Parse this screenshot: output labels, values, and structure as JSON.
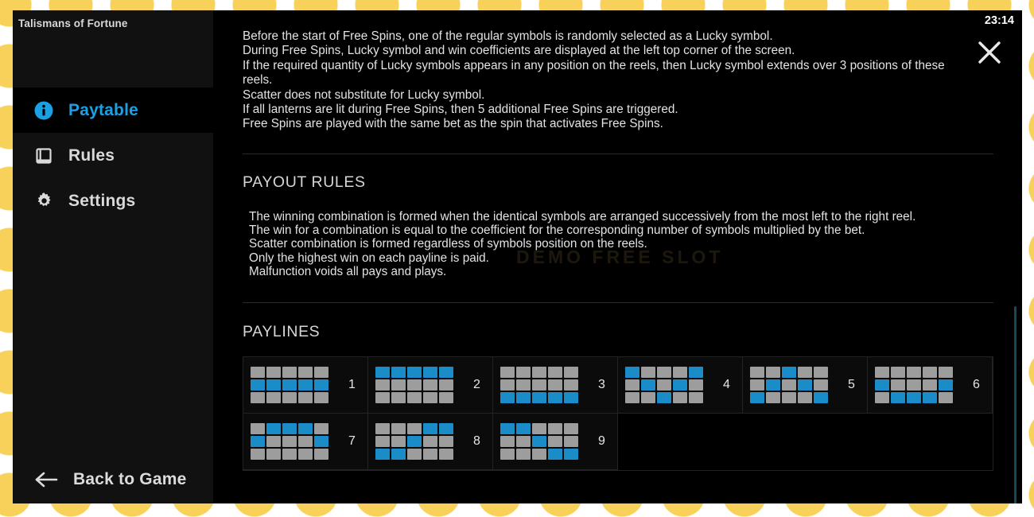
{
  "window": {
    "game_title": "Talismans of Fortune",
    "clock": "23:14",
    "close_icon": "close-x-icon",
    "watermark": "DEMO  FREE SLOT",
    "accent_blue": "#1ca0e4",
    "cell_blue": "#1a8cc8",
    "cell_gray": "#9d9d9d",
    "panel_bg": "#000000",
    "sidebar_bg": "#111111"
  },
  "sidebar": {
    "items": [
      {
        "label": "Paytable",
        "icon": "info-circle-icon",
        "active": true
      },
      {
        "label": "Rules",
        "icon": "book-icon",
        "active": false
      },
      {
        "label": "Settings",
        "icon": "gear-icon",
        "active": false
      }
    ],
    "back": {
      "label": "Back to Game",
      "icon": "arrow-left-icon"
    }
  },
  "main": {
    "intro_lines": [
      "Before the start of Free Spins, one of the regular symbols is randomly selected as a Lucky symbol.",
      "During Free Spins, Lucky symbol and win coefficients are displayed at the left top corner of the screen.",
      "If the required quantity of Lucky symbols appears in any position on the reels, then Lucky symbol extends over 3 positions of these reels.",
      "Scatter does not substitute for Lucky symbol.",
      "If all lanterns are lit during Free Spins, then 5 additional Free Spins are triggered.",
      "Free Spins are played with the same bet as the spin that activates Free Spins."
    ],
    "payout_rules_heading": "PAYOUT RULES",
    "payout_rules_lines": [
      "The winning combination is formed when the identical symbols are arranged successively from the most left to the right reel.",
      "The win for a combination is equal to the coefficient for the corresponding number of symbols multiplied by the bet.",
      "Scatter combination is formed regardless of symbols position on the reels.",
      "Only the highest win on each payline is paid.",
      "Malfunction voids all pays and plays."
    ],
    "paylines_heading": "PAYLINES",
    "paylines": [
      {
        "number": "1",
        "cells": [
          0,
          0,
          0,
          0,
          0,
          1,
          1,
          1,
          1,
          1,
          0,
          0,
          0,
          0,
          0
        ]
      },
      {
        "number": "2",
        "cells": [
          1,
          1,
          1,
          1,
          1,
          0,
          0,
          0,
          0,
          0,
          0,
          0,
          0,
          0,
          0
        ]
      },
      {
        "number": "3",
        "cells": [
          0,
          0,
          0,
          0,
          0,
          0,
          0,
          0,
          0,
          0,
          1,
          1,
          1,
          1,
          1
        ]
      },
      {
        "number": "4",
        "cells": [
          1,
          0,
          0,
          0,
          1,
          0,
          1,
          0,
          1,
          0,
          0,
          0,
          1,
          0,
          0
        ]
      },
      {
        "number": "5",
        "cells": [
          0,
          0,
          1,
          0,
          0,
          0,
          1,
          0,
          1,
          0,
          1,
          0,
          0,
          0,
          1
        ]
      },
      {
        "number": "6",
        "cells": [
          0,
          0,
          0,
          0,
          0,
          1,
          0,
          0,
          0,
          1,
          0,
          1,
          1,
          1,
          0
        ]
      },
      {
        "number": "7",
        "cells": [
          0,
          1,
          1,
          1,
          0,
          1,
          0,
          0,
          0,
          1,
          0,
          0,
          0,
          0,
          0
        ]
      },
      {
        "number": "8",
        "cells": [
          0,
          0,
          0,
          1,
          1,
          0,
          0,
          1,
          0,
          0,
          1,
          1,
          0,
          0,
          0
        ]
      },
      {
        "number": "9",
        "cells": [
          1,
          1,
          0,
          0,
          0,
          0,
          0,
          1,
          0,
          0,
          0,
          0,
          0,
          1,
          1
        ]
      }
    ]
  }
}
